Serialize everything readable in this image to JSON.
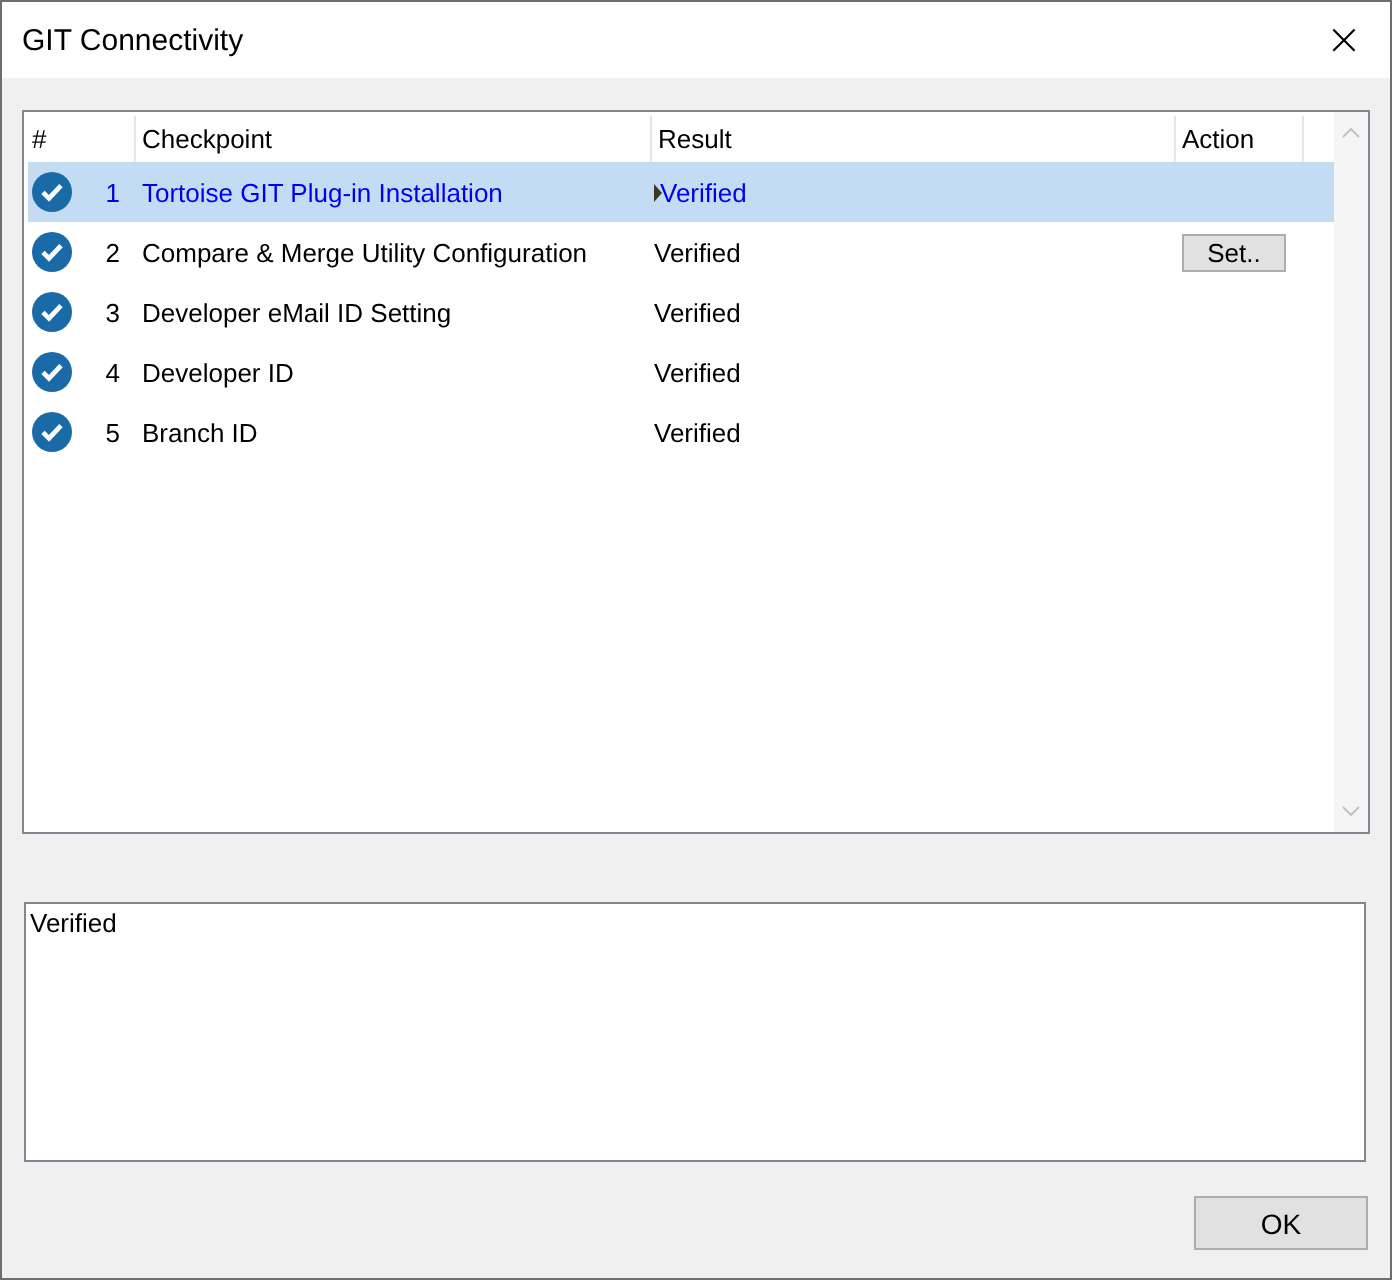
{
  "window": {
    "title": "GIT Connectivity",
    "close": "×"
  },
  "table": {
    "columns": [
      "#",
      "Checkpoint",
      "Result",
      "Action"
    ],
    "rows": [
      {
        "number": "1",
        "checkpoint": "Tortoise GIT Plug-in Installation",
        "result": "Verified",
        "selected": true
      },
      {
        "number": "2",
        "checkpoint": "Compare & Merge Utility Configuration",
        "result": "Verified",
        "action": "Set..",
        "selected": false
      },
      {
        "number": "3",
        "checkpoint": "Developer eMail ID Setting",
        "result": "Verified",
        "selected": false
      },
      {
        "number": "4",
        "checkpoint": "Developer ID",
        "result": "Verified",
        "selected": false
      },
      {
        "number": "5",
        "checkpoint": "Branch ID",
        "result": "Verified",
        "selected": false
      }
    ]
  },
  "details": {
    "text": "Verified"
  },
  "buttons": [
    "OK"
  ]
}
